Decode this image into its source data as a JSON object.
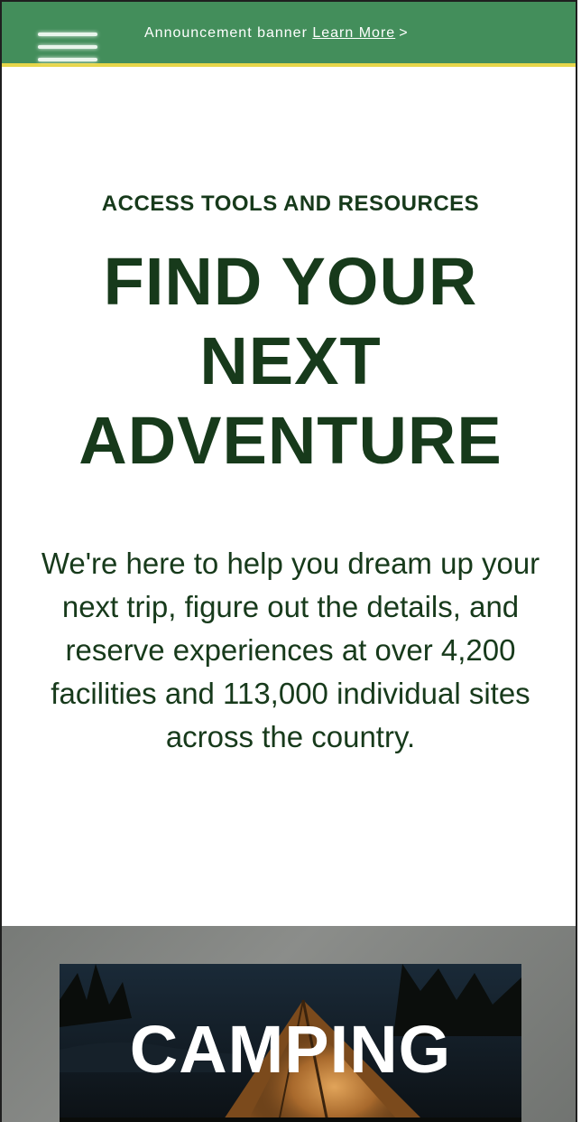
{
  "header": {
    "menu_icon": "hamburger-menu-icon",
    "announcement_text": "Announcement banner",
    "learn_more_label": "Learn More",
    "learn_more_chevron": ">"
  },
  "hero": {
    "eyebrow": "ACCESS TOOLS AND RESOURCES",
    "headline": "FIND YOUR NEXT ADVENTURE",
    "intro": "We're here to help you dream up your next trip, figure out the details, and reserve experiences at over 4,200 facilities and 113,000 individual sites across the country."
  },
  "categories": [
    {
      "title": "CAMPING",
      "image_icon": "tent-photo"
    }
  ],
  "colors": {
    "banner_green": "#438e5b",
    "banner_underline": "#e7d64a",
    "text_dark_green": "#173a1b"
  }
}
